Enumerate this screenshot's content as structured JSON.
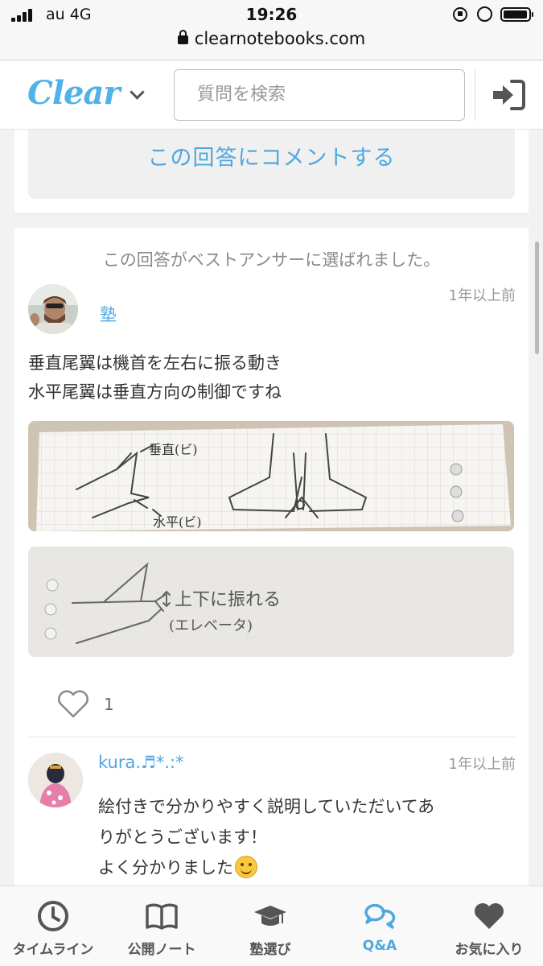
{
  "status_bar": {
    "carrier": "au  4G",
    "time": "19:26",
    "url": "clearnotebooks.com"
  },
  "header": {
    "logo": "Clear",
    "search_placeholder": "質問を検索"
  },
  "comment_button": "この回答にコメントする",
  "answer": {
    "best_answer_label": "この回答がベストアンサーに選ばれました。",
    "username": "塾",
    "timestamp": "1年以上前",
    "lines": [
      "垂直尾翼は機首を左右に振る動き",
      "水平尾翼は垂直方向の制御ですね"
    ],
    "image1_labels": [
      "垂直(ビ)",
      "水平(ビ)"
    ],
    "image2_labels": [
      "上下に振れる",
      "(エレベータ)"
    ],
    "like_count": "1"
  },
  "reply": {
    "username": "kura.♬*.:*",
    "timestamp": "1年以上前",
    "lines": [
      "絵付きで分かりやすく説明していただいてあ",
      "りがとうございます！",
      "よく分かりました"
    ]
  },
  "tab_bar": {
    "tabs": [
      {
        "label": "タイムライン",
        "icon": "clock-icon"
      },
      {
        "label": "公開ノート",
        "icon": "book-icon"
      },
      {
        "label": "塾選び",
        "icon": "graduation-cap-icon"
      },
      {
        "label": "Q&A",
        "icon": "chat-bubbles-icon"
      },
      {
        "label": "お気に入り",
        "icon": "heart-icon"
      }
    ],
    "active_tab": "Q&A"
  },
  "colors": {
    "accent": "#4ea8df",
    "logo": "#4fb3e8",
    "background": "#f2f2f2"
  }
}
